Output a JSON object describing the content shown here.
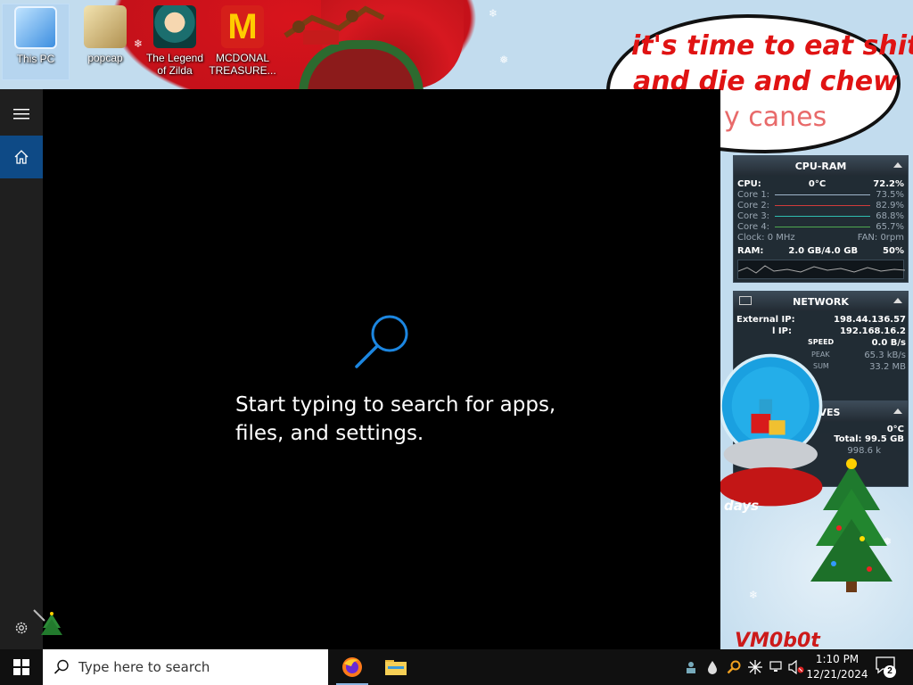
{
  "desktop": {
    "icons": [
      {
        "label": "This PC"
      },
      {
        "label": "popcap"
      },
      {
        "label": "The Legend of Zilda"
      },
      {
        "label": "MCDONAL TREASURE..."
      }
    ],
    "bubble_lines": [
      "it's time to eat shit",
      "and die and chew",
      "y canes"
    ],
    "signature": "VM0b0t",
    "globe_caption": "days"
  },
  "start": {
    "hint": "Start typing to search for apps, files, and settings.",
    "rail": {
      "menu": "menu-icon",
      "home": "home-icon",
      "settings": "gear-icon"
    }
  },
  "widgets": {
    "cpu_ram": {
      "title": "CPU-RAM",
      "cpu_label": "CPU:",
      "temp": "0°C",
      "cpu_pct": "72.2%",
      "cores": [
        {
          "label": "Core 1:",
          "value": "73.5%",
          "color": "#9fb5c9"
        },
        {
          "label": "Core 2:",
          "value": "82.9%",
          "color": "#d23b3b"
        },
        {
          "label": "Core 3:",
          "value": "68.8%",
          "color": "#2fbdb0"
        },
        {
          "label": "Core 4:",
          "value": "65.7%",
          "color": "#4fa84f"
        }
      ],
      "clock": "Clock: 0 MHz",
      "fan": "FAN: 0rpm",
      "ram_label": "RAM:",
      "ram_used": "2.0 GB/4.0 GB",
      "ram_pct": "50%"
    },
    "network": {
      "title": "NETWORK",
      "ext_label": "External IP:",
      "ext_ip": "198.44.136.57",
      "int_label": "l IP:",
      "int_ip": "192.168.16.2",
      "speed_label": "SPEED",
      "speed": "0.0 B/s",
      "peak_label": "PEAK",
      "peak": "65.3 kB/s",
      "sum_label": "SUM",
      "sum": "33.2 MB"
    },
    "drives": {
      "title": "VES",
      "temp": "0°C",
      "total": "Total: 99.5 GB",
      "rate": "998.6 k"
    }
  },
  "taskbar": {
    "search_placeholder": "Type here to search",
    "apps": [
      "firefox-icon",
      "file-explorer-icon"
    ],
    "clock_time": "1:10 PM",
    "clock_date": "12/21/2024",
    "notification_count": "2",
    "accent": "#0e4a86"
  }
}
